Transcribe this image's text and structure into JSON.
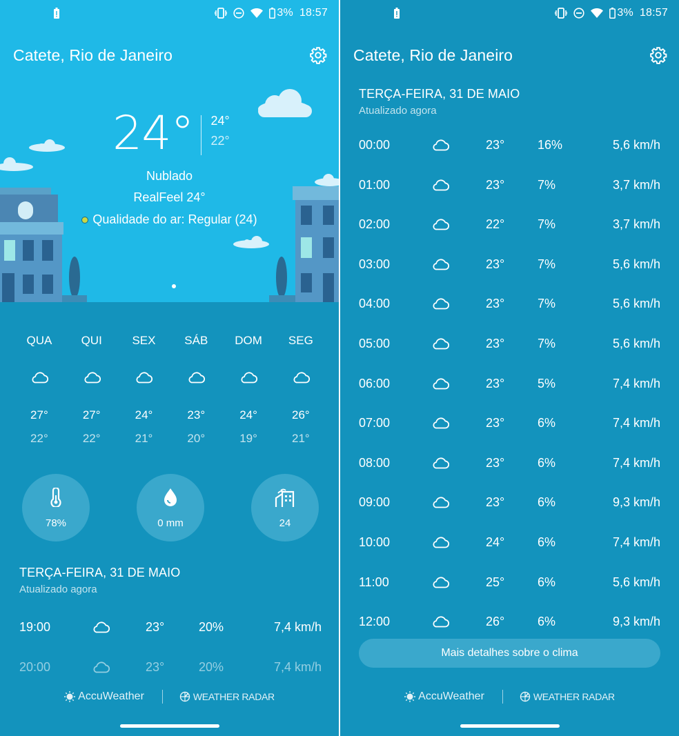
{
  "status_bar": {
    "battery_pct": "3%",
    "time": "18:57"
  },
  "location": "Catete, Rio de Janeiro",
  "hero": {
    "temp_now": "24°",
    "temp_high": "24°",
    "temp_low": "22°",
    "condition": "Nublado",
    "realfeel": "RealFeel 24°",
    "air_quality": "Qualidade do ar: Regular (24)",
    "air_quality_color": "#c9d745"
  },
  "forecast": [
    {
      "day": "QUA",
      "icon": "cloud-icon",
      "hi": "27°",
      "lo": "22°"
    },
    {
      "day": "QUI",
      "icon": "cloud-icon",
      "hi": "27°",
      "lo": "22°"
    },
    {
      "day": "SEX",
      "icon": "cloud-icon",
      "hi": "24°",
      "lo": "21°"
    },
    {
      "day": "SÁB",
      "icon": "cloud-icon",
      "hi": "23°",
      "lo": "20°"
    },
    {
      "day": "DOM",
      "icon": "cloud-icon",
      "hi": "24°",
      "lo": "19°"
    },
    {
      "day": "SEG",
      "icon": "cloud-icon",
      "hi": "26°",
      "lo": "21°"
    }
  ],
  "stats": {
    "humidity": {
      "icon": "thermometer-icon",
      "value": "78%"
    },
    "precipitation": {
      "icon": "water-drop-icon",
      "value": "0 mm"
    },
    "air_quality": {
      "icon": "air-quality-icon",
      "value": "24"
    }
  },
  "hourly_section": {
    "title": "TERÇA-FEIRA, 31 DE MAIO",
    "updated": "Atualizado agora"
  },
  "hourly_left": [
    {
      "time": "19:00",
      "temp": "23°",
      "precip": "20%",
      "wind": "7,4 km/h"
    },
    {
      "time": "20:00",
      "temp": "23°",
      "precip": "20%",
      "wind": "7,4 km/h"
    }
  ],
  "hourly_right": [
    {
      "time": "00:00",
      "temp": "23°",
      "precip": "16%",
      "wind": "5,6 km/h"
    },
    {
      "time": "01:00",
      "temp": "23°",
      "precip": "7%",
      "wind": "3,7 km/h"
    },
    {
      "time": "02:00",
      "temp": "22°",
      "precip": "7%",
      "wind": "3,7 km/h"
    },
    {
      "time": "03:00",
      "temp": "23°",
      "precip": "7%",
      "wind": "5,6 km/h"
    },
    {
      "time": "04:00",
      "temp": "23°",
      "precip": "7%",
      "wind": "5,6 km/h"
    },
    {
      "time": "05:00",
      "temp": "23°",
      "precip": "7%",
      "wind": "5,6 km/h"
    },
    {
      "time": "06:00",
      "temp": "23°",
      "precip": "5%",
      "wind": "7,4 km/h"
    },
    {
      "time": "07:00",
      "temp": "23°",
      "precip": "6%",
      "wind": "7,4 km/h"
    },
    {
      "time": "08:00",
      "temp": "23°",
      "precip": "6%",
      "wind": "7,4 km/h"
    },
    {
      "time": "09:00",
      "temp": "23°",
      "precip": "6%",
      "wind": "9,3 km/h"
    },
    {
      "time": "10:00",
      "temp": "24°",
      "precip": "6%",
      "wind": "7,4 km/h"
    },
    {
      "time": "11:00",
      "temp": "25°",
      "precip": "6%",
      "wind": "5,6 km/h"
    },
    {
      "time": "12:00",
      "temp": "26°",
      "precip": "6%",
      "wind": "9,3 km/h"
    }
  ],
  "more_details_label": "Mais detalhes sobre o clima",
  "footer": {
    "brand_1": "AccuWeather",
    "brand_2": "WEATHER RADAR"
  }
}
